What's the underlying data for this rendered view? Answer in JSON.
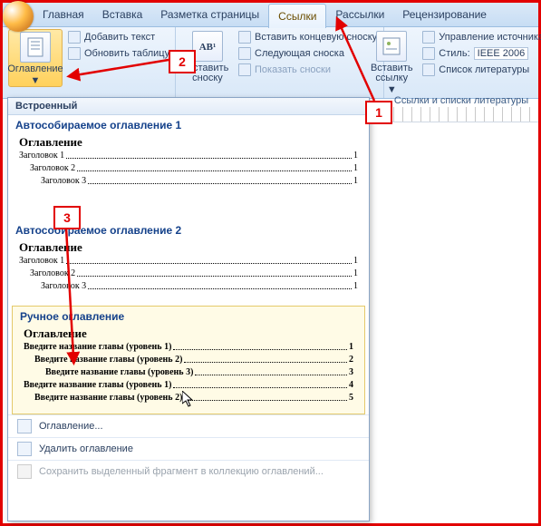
{
  "tabs": {
    "home": "Главная",
    "insert": "Вставка",
    "layout": "Разметка страницы",
    "references": "Ссылки",
    "mailings": "Рассылки",
    "review": "Рецензирование"
  },
  "ribbon": {
    "toc": {
      "big": "Оглавление",
      "add_text": "Добавить текст",
      "update": "Обновить таблицу"
    },
    "footnotes": {
      "icon_letters": "AB¹",
      "big": "Вставить\nсноску",
      "end": "Вставить концевую сноску",
      "next": "Следующая сноска",
      "show": "Показать сноски"
    },
    "links": {
      "big": "Вставить\nссылку",
      "manage": "Управление источниками",
      "style_label": "Стиль:",
      "style_value": "IEEE 2006",
      "biblio": "Список литературы",
      "group_label": "Ссылки и списки литературы"
    }
  },
  "gallery": {
    "section": "Встроенный",
    "auto1_title": "Автособираемое оглавление 1",
    "auto2_title": "Автособираемое оглавление 2",
    "toc_head": "Оглавление",
    "h1": "Заголовок 1",
    "h2": "Заголовок 2",
    "h3": "Заголовок 3",
    "pg1": "1",
    "manual_title": "Ручное оглавление",
    "manual_l1": "Введите название главы (уровень 1)",
    "manual_l2": "Введите название главы (уровень 2)",
    "manual_l3": "Введите название главы (уровень 3)",
    "mp1": "1",
    "mp2": "2",
    "mp3": "3",
    "mp4": "4",
    "mp5": "5",
    "menu_custom": "Оглавление...",
    "menu_remove": "Удалить оглавление",
    "menu_save": "Сохранить выделенный фрагмент в коллекцию оглавлений..."
  },
  "callouts": {
    "c1": "1",
    "c2": "2",
    "c3": "3"
  }
}
